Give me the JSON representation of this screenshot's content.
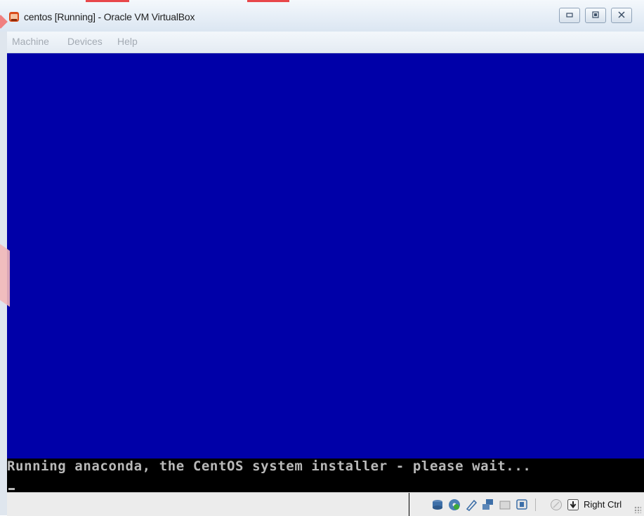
{
  "window": {
    "title": "centos [Running] - Oracle VM VirtualBox",
    "app_icon": "virtualbox-icon",
    "controls": [
      "minimize-icon",
      "maximize-icon",
      "close-icon"
    ]
  },
  "menu": {
    "items": [
      {
        "label": "Machine"
      },
      {
        "label": "Devices"
      },
      {
        "label": "Help"
      }
    ]
  },
  "console": {
    "message": "Running anaconda, the CentOS system installer - please wait...",
    "cursor": "_"
  },
  "statusbar": {
    "icons": [
      "hard-disk-icon",
      "optical-drive-icon",
      "usb-icon",
      "network-icon",
      "shared-folders-icon",
      "display-icon",
      "mouse-integration-icon",
      "keyboard-capture-icon"
    ],
    "host_key_label": "Right Ctrl"
  },
  "colors": {
    "vm_screen": "#0000a8",
    "console_bg": "#000000",
    "console_text": "#b9b9b9"
  }
}
